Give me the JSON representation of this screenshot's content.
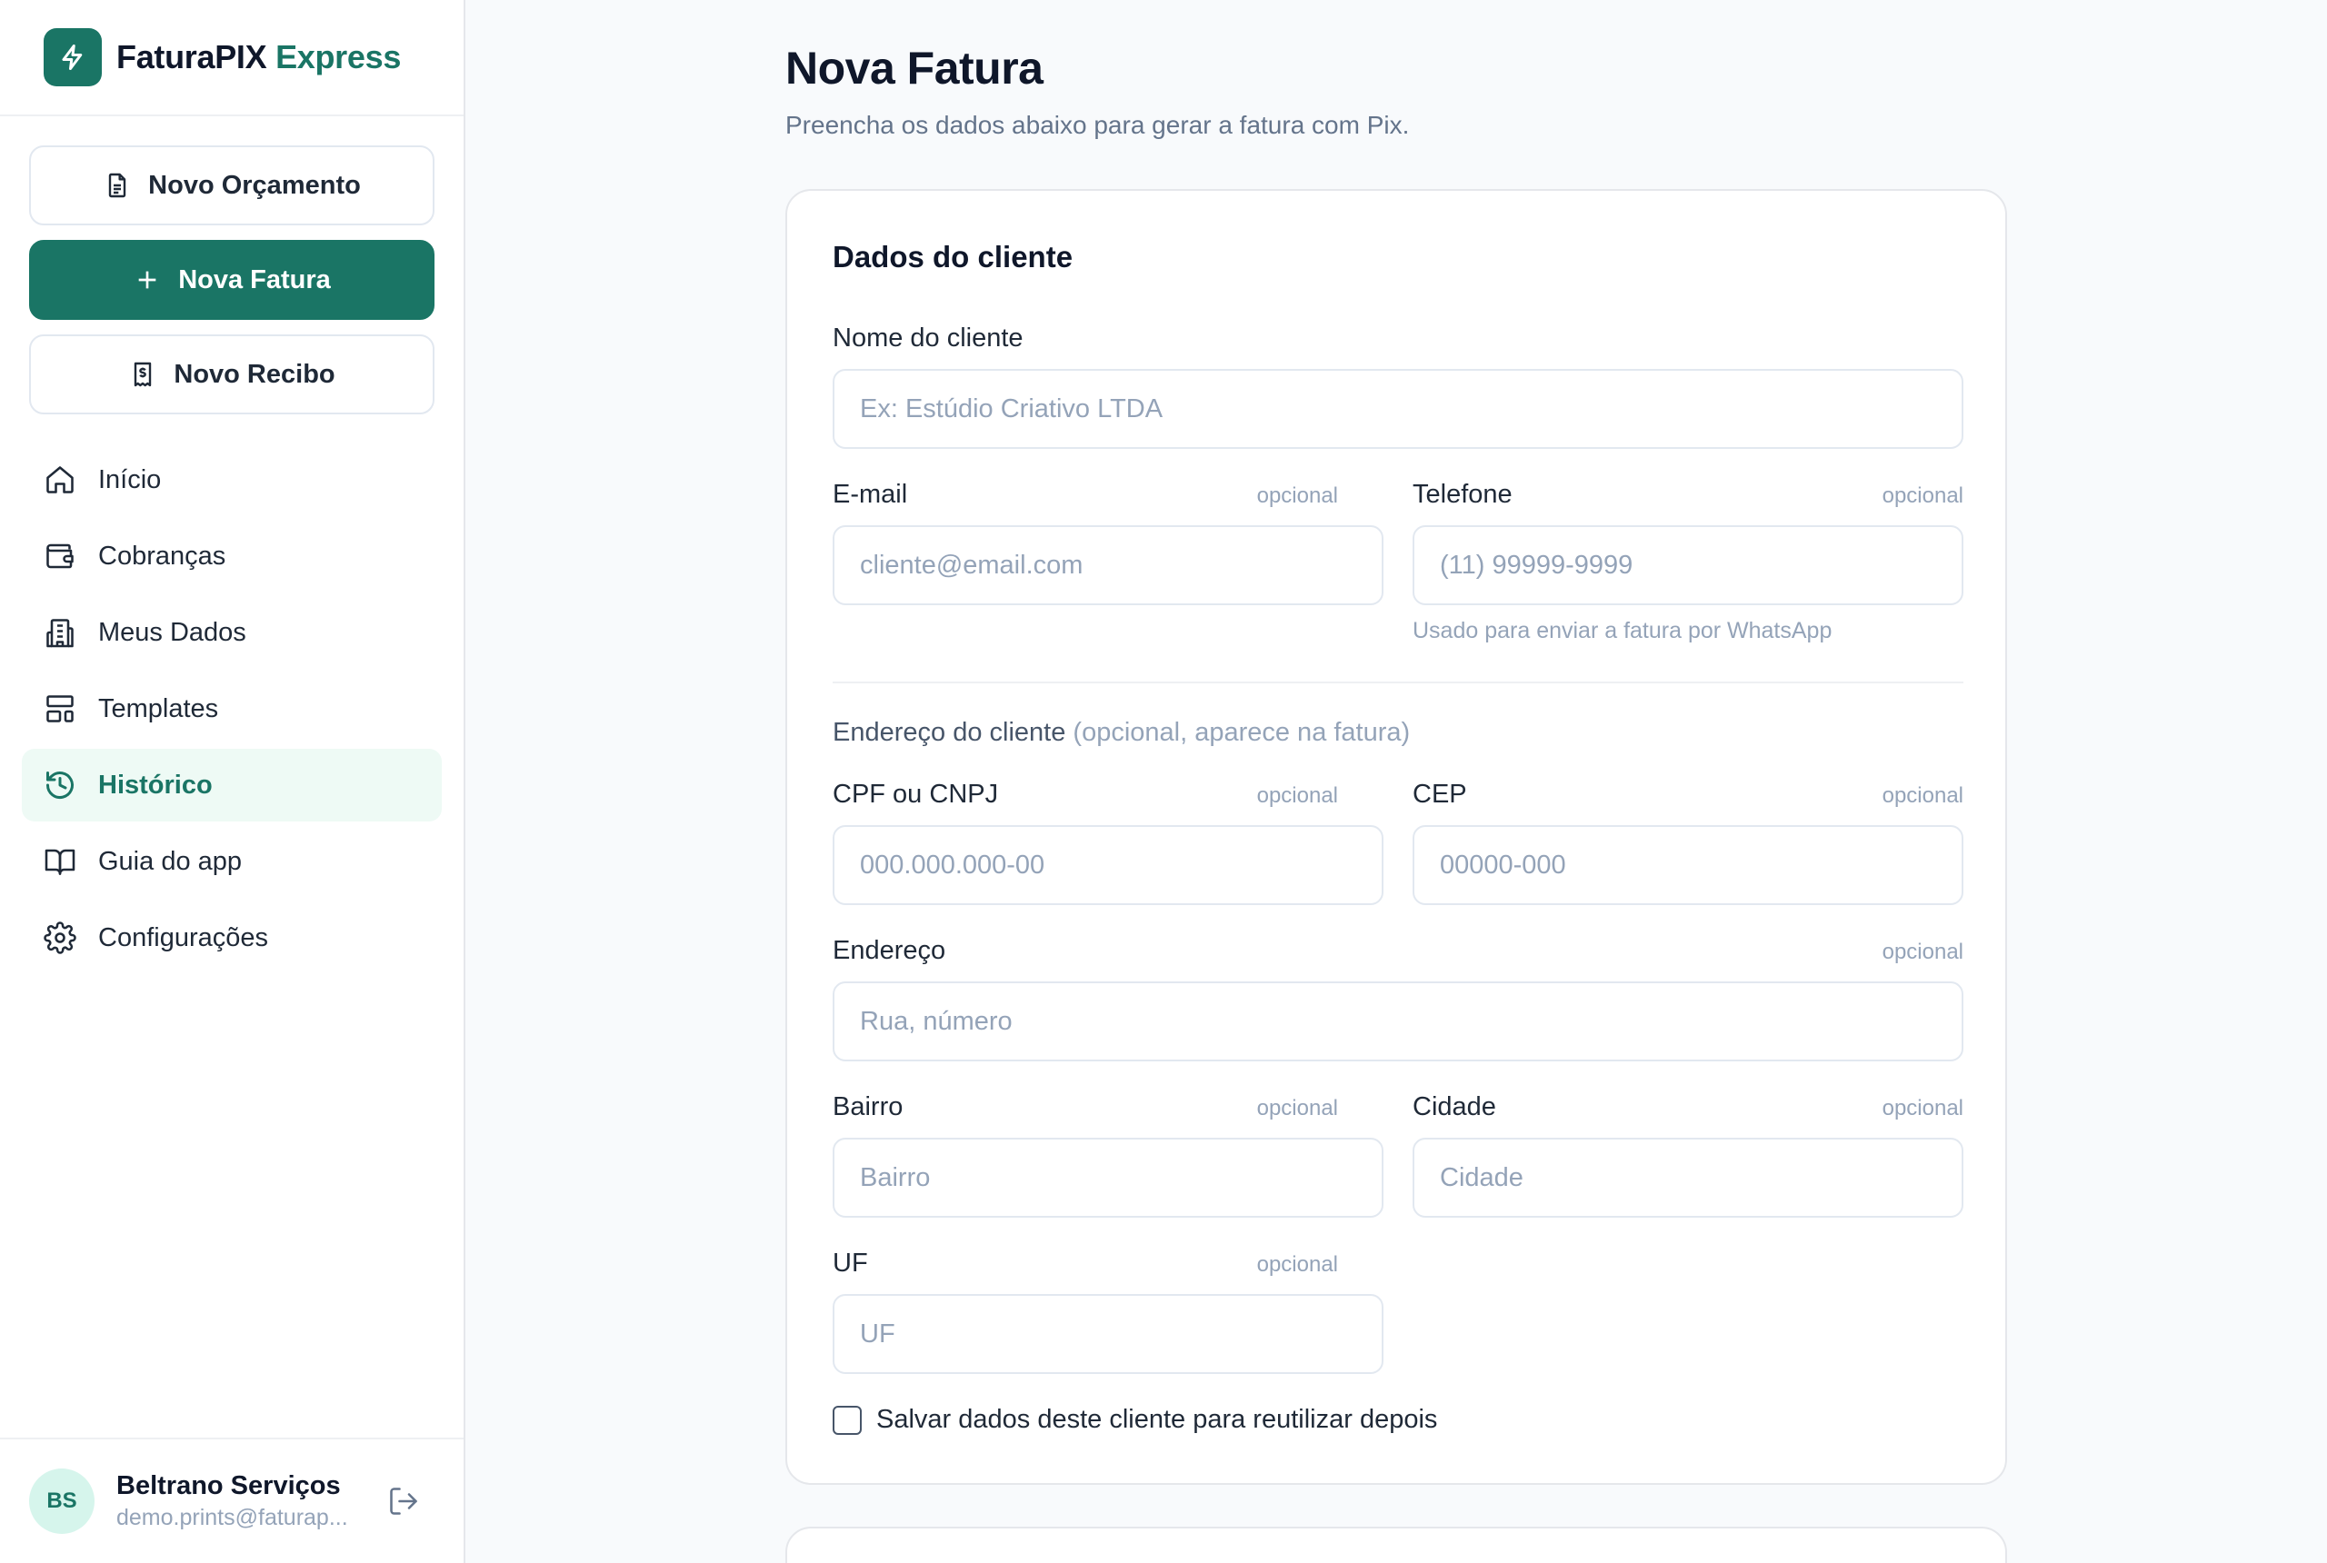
{
  "brand": {
    "name": "FaturaPIX",
    "accent": "Express",
    "logo_icon": "lightning-bolt-icon",
    "color": "#1a7565"
  },
  "actions": {
    "new_quote": "Novo Orçamento",
    "new_invoice": "Nova Fatura",
    "new_receipt": "Novo Recibo"
  },
  "nav": {
    "items": [
      {
        "label": "Início",
        "icon": "home-icon"
      },
      {
        "label": "Cobranças",
        "icon": "wallet-icon"
      },
      {
        "label": "Meus Dados",
        "icon": "building-icon"
      },
      {
        "label": "Templates",
        "icon": "layout-icon"
      },
      {
        "label": "Histórico",
        "icon": "history-icon",
        "active": true
      },
      {
        "label": "Guia do app",
        "icon": "book-icon"
      },
      {
        "label": "Configurações",
        "icon": "gear-icon"
      }
    ]
  },
  "user": {
    "initials": "BS",
    "name": "Beltrano Serviços",
    "email": "demo.prints@faturap..."
  },
  "page": {
    "title": "Nova Fatura",
    "subtitle": "Preencha os dados abaixo para gerar a fatura com Pix."
  },
  "form": {
    "section_title": "Dados do cliente",
    "optional": "opcional",
    "client_name": {
      "label": "Nome do cliente",
      "placeholder": "Ex: Estúdio Criativo LTDA"
    },
    "email": {
      "label": "E-mail",
      "placeholder": "cliente@email.com"
    },
    "phone": {
      "label": "Telefone",
      "placeholder": "(11) 99999-9999",
      "hint": "Usado para enviar a fatura por WhatsApp"
    },
    "address_section": {
      "title": "Endereço do cliente",
      "note": "(opcional, aparece na fatura)"
    },
    "cpf": {
      "label": "CPF ou CNPJ",
      "placeholder": "000.000.000-00"
    },
    "cep": {
      "label": "CEP",
      "placeholder": "00000-000"
    },
    "address": {
      "label": "Endereço",
      "placeholder": "Rua, número"
    },
    "district": {
      "label": "Bairro",
      "placeholder": "Bairro"
    },
    "city": {
      "label": "Cidade",
      "placeholder": "Cidade"
    },
    "state": {
      "label": "UF",
      "placeholder": "UF"
    },
    "save_client": "Salvar dados deste cliente para reutilizar depois"
  }
}
